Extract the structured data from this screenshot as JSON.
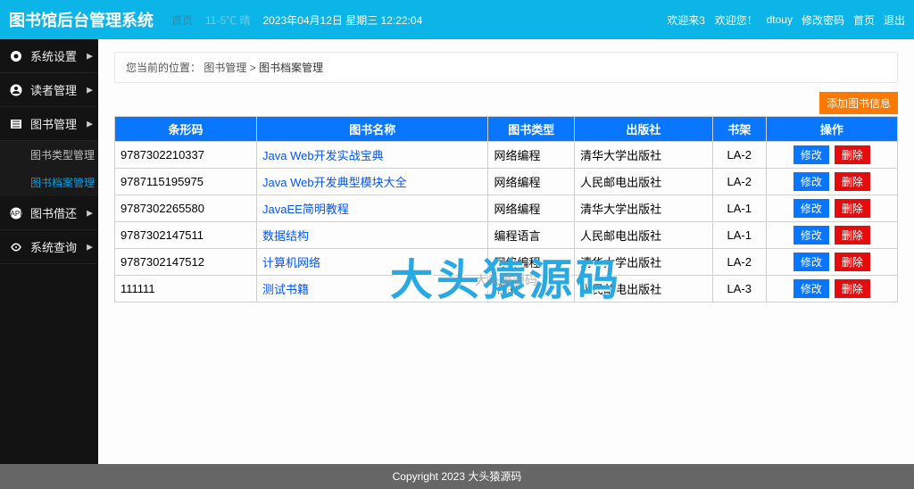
{
  "topbar": {
    "brand": "图书馆后台管理系统",
    "nav_home": "首页",
    "weather": "11-5℃ 晴",
    "datetime": "2023年04月12日 星期三 12:22:04",
    "welcome": "欢迎来3",
    "greet": "欢迎您！",
    "user": "dtouy",
    "change_pwd": "修改密码",
    "home": "首页",
    "logout": "退出"
  },
  "sidebar": {
    "groups": [
      {
        "icon": "gear",
        "label": "系统设置"
      },
      {
        "icon": "reader",
        "label": "读者管理"
      },
      {
        "icon": "book",
        "label": "图书管理"
      },
      {
        "icon": "loan",
        "label": "图书借还"
      },
      {
        "icon": "query",
        "label": "系统查询"
      }
    ],
    "book_subs": [
      "图书类型管理",
      "图书档案管理"
    ]
  },
  "breadcrumb": {
    "label": "您当前的位置：",
    "p1": "图书管理",
    "sep": ">",
    "p2": "图书档案管理"
  },
  "addBtn": "添加图书信息",
  "table": {
    "headers": [
      "条形码",
      "图书名称",
      "图书类型",
      "出版社",
      "书架",
      "操作"
    ],
    "editLabel": "修改",
    "delLabel": "删除",
    "rows": [
      {
        "barcode": "9787302210337",
        "name": "Java Web开发实战宝典",
        "type": "网络编程",
        "publisher": "清华大学出版社",
        "shelf": "LA-2"
      },
      {
        "barcode": "9787115195975",
        "name": "Java Web开发典型模块大全",
        "type": "网络编程",
        "publisher": "人民邮电出版社",
        "shelf": "LA-2"
      },
      {
        "barcode": "9787302265580",
        "name": "JavaEE简明教程",
        "type": "网络编程",
        "publisher": "清华大学出版社",
        "shelf": "LA-1"
      },
      {
        "barcode": "9787302147511",
        "name": "数据结构",
        "type": "编程语言",
        "publisher": "人民邮电出版社",
        "shelf": "LA-1"
      },
      {
        "barcode": "9787302147512",
        "name": "计算机网络",
        "type": "网络编程",
        "publisher": "清华大学出版社",
        "shelf": "LA-2"
      },
      {
        "barcode": "111111",
        "name": "测试书籍",
        "type": "测试",
        "publisher": "人民邮电出版社",
        "shelf": "LA-3"
      }
    ]
  },
  "watermark": {
    "big": "大头猿源码",
    "small": "大头猿源码"
  },
  "footer": "Copyright 2023 大头猿源码"
}
